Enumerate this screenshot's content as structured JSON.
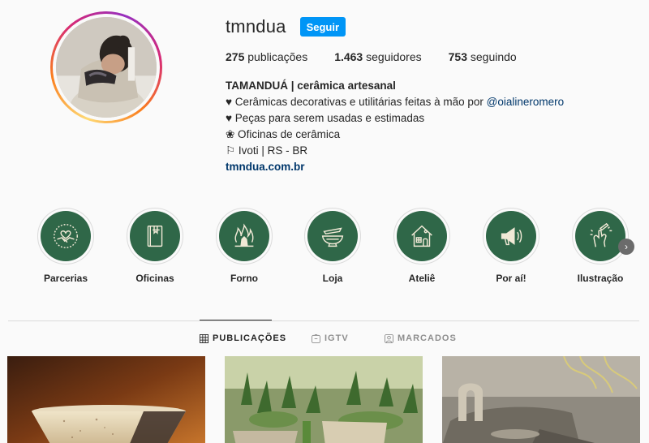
{
  "profile": {
    "username": "tmndua",
    "follow_label": "Seguir",
    "stats": {
      "posts_count": "275",
      "posts_label": "publicações",
      "followers_count": "1.463",
      "followers_label": "seguidores",
      "following_count": "753",
      "following_label": "seguindo"
    },
    "bio": {
      "name": "TAMANDUÁ | cerâmica artesanal",
      "line1_text": "♥ Cerâmicas decorativas e utilitárias feitas à mão por ",
      "line1_mention": "@oialineromero",
      "line2": "♥ Peças para serem usadas e estimadas",
      "line3": "❀ Oficinas de cerâmica",
      "line4": "⚐ Ivoti | RS - BR",
      "website": "tmndua.com.br"
    }
  },
  "highlights": [
    {
      "label": "Parcerias",
      "icon": "handshake-heart-icon"
    },
    {
      "label": "Oficinas",
      "icon": "book-icon"
    },
    {
      "label": "Forno",
      "icon": "fire-icon"
    },
    {
      "label": "Loja",
      "icon": "bowls-icon"
    },
    {
      "label": "Ateliê",
      "icon": "house-icon"
    },
    {
      "label": "Por aí!",
      "icon": "megaphone-icon"
    },
    {
      "label": "Ilustração",
      "icon": "hand-pencil-icon"
    }
  ],
  "tabs": [
    {
      "label": "PUBLICAÇÕES",
      "icon": "grid-icon",
      "active": true
    },
    {
      "label": "IGTV",
      "icon": "igtv-icon",
      "active": false
    },
    {
      "label": "MARCADOS",
      "icon": "tagged-icon",
      "active": false
    }
  ],
  "colors": {
    "accent": "#0095f6",
    "highlight_bg": "#2f6748",
    "link": "#00376b"
  }
}
